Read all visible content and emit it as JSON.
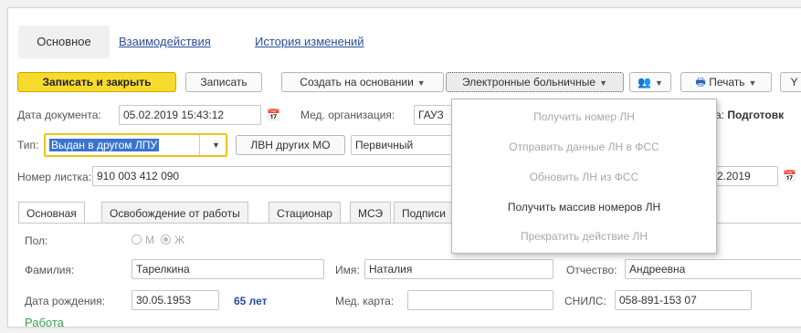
{
  "top_tabs": [
    "Основное",
    "Взаимодействия",
    "История изменений"
  ],
  "toolbar": {
    "save_close": "Записать и закрыть",
    "save": "Записать",
    "create_based": "Создать на основании",
    "electronic_sick_leaves": "Электронные больничные",
    "print": "Печать",
    "more": "Y"
  },
  "dropdown_items": [
    {
      "label": "Получить номер ЛН",
      "enabled": false
    },
    {
      "label": "Отправить данные ЛН в ФСС",
      "enabled": false
    },
    {
      "label": "Обновить ЛН из ФСС",
      "enabled": false
    },
    {
      "label": "Получить массив номеров ЛН",
      "enabled": true
    },
    {
      "label": "Прекратить действие ЛН",
      "enabled": false
    }
  ],
  "form": {
    "doc_date_label": "Дата документа:",
    "doc_date_value": "05.02.2019 15:43:12",
    "med_org_label": "Мед. организация:",
    "med_org_value": "ГАУЗ",
    "status_prefix": "а:",
    "status_value": "Подготовк",
    "type_label": "Тип:",
    "type_value": "Выдан в другом ЛПУ",
    "lvn_other_btn": "ЛВН других МО",
    "primary_value": "Первичный",
    "sheet_no_label": "Номер листка:",
    "sheet_no_value": "910 003 412 090",
    "right_date_fragment": "2.2019"
  },
  "inner_tabs": [
    "Основная",
    "Освобождение от работы",
    "Стационар",
    "МСЭ",
    "Подписи"
  ],
  "person": {
    "gender_label": "Пол:",
    "gender_m": "М",
    "gender_f": "Ж",
    "surname_label": "Фамилия:",
    "surname_value": "Тарелкина",
    "name_label": "Имя:",
    "name_value": "Наталия",
    "patronymic_label": "Отчество:",
    "patronymic_value": "Андреевна",
    "birth_label": "Дата рождения:",
    "birth_value": "30.05.1953",
    "age": "65 лет",
    "medcard_label": "Мед. карта:",
    "medcard_value": "",
    "snils_label": "СНИЛС:",
    "snils_value": "058-891-153 07",
    "work_link": "Работа"
  },
  "colors": {
    "primary": "#f6da2e",
    "link": "#2a4e9a",
    "age": "#2a4e9a",
    "work_link": "#3aa04a"
  }
}
